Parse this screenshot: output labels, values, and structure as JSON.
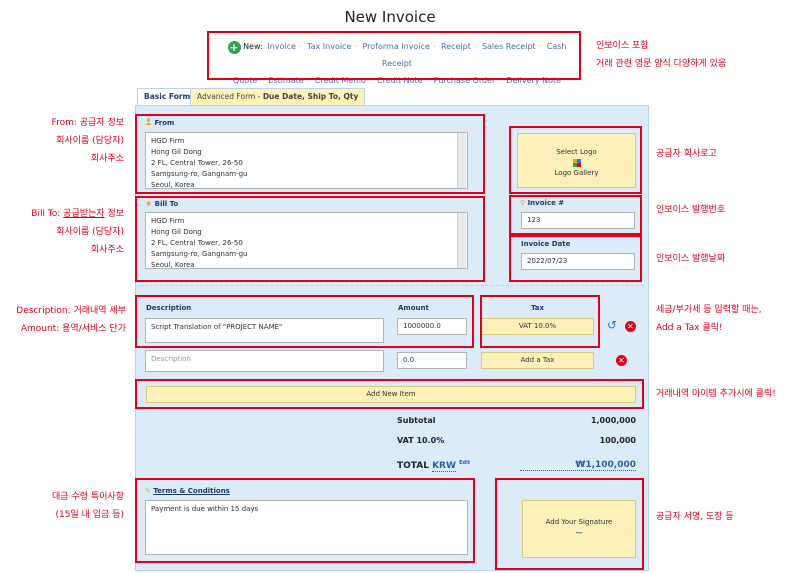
{
  "page": {
    "title": "New Invoice"
  },
  "new_bar": {
    "prefix": "New:",
    "items": [
      "Invoice",
      "Tax Invoice",
      "Proforma Invoice",
      "Receipt",
      "Sales Receipt",
      "Cash Receipt",
      "Quote",
      "Estimate",
      "Credit Memo",
      "Credit Note",
      "Purchase Order",
      "Delivery Note"
    ]
  },
  "tabs": {
    "basic": "Basic Form",
    "advanced_prefix": "Advanced Form - ",
    "advanced_bold": "Due Date, Ship To, Qty"
  },
  "from": {
    "label": "From",
    "lines": [
      "HGD Firm",
      "Hong Gil Dong",
      "2 FL, Central Tower, 26-50",
      "Samgsung-ro, Gangnam-gu",
      "Seoul, Korea"
    ]
  },
  "bill_to": {
    "label": "Bill To",
    "lines": [
      "HGD Firm",
      "Hong Gil Dong",
      "2 FL, Central Tower, 26-50",
      "Samgsung-ro, Gangnam-gu",
      "Seoul, Korea"
    ]
  },
  "logo": {
    "select": "Select Logo",
    "gallery": "Logo Gallery"
  },
  "invoice_no": {
    "label": "Invoice #",
    "value": "123"
  },
  "invoice_date": {
    "label": "Invoice Date",
    "value": "2022/07/23"
  },
  "items_header": {
    "description": "Description",
    "amount": "Amount",
    "tax": "Tax"
  },
  "item1": {
    "description": "Script Translation of \"PROJECT NAME\"",
    "amount": "1000000.0",
    "tax": "VAT 10.0%"
  },
  "item2": {
    "description_placeholder": "Description",
    "amount": "0.0",
    "tax_button": "Add a Tax"
  },
  "add_item": "Add New Item",
  "totals": {
    "subtotal_label": "Subtotal",
    "subtotal_value": "1,000,000",
    "vat_label": "VAT 10.0%",
    "vat_value": "100,000",
    "total_label": "TOTAL",
    "currency": "KRW",
    "edit": "Edit",
    "total_value": "₩1,100,000"
  },
  "terms": {
    "label": "Terms & Conditions",
    "value": "Payment is due within 15 days"
  },
  "signature": {
    "label": "Add Your Signature"
  },
  "annotations": {
    "from_1": "From: 공급자 정보",
    "from_2": "회사이름 (담당자)",
    "from_3": "회사주소",
    "bill_1a": "Bill To: ",
    "bill_1b": "공급받는자",
    "bill_1c": " 정보",
    "bill_2": "회사이름 (담당자)",
    "bill_3": "회사주소",
    "desc_1": "Description: 거래내역 세부",
    "desc_2": "Amount: 용역/서비스 단가",
    "terms_1": "대금 수령 특이사항",
    "terms_2": "(15일 내 입금 등)",
    "invtypes_1": "인보이스 포함",
    "invtypes_2": "거래 관련 영문 양식 다양하게 있음",
    "logo": "공급자 회사로고",
    "invno": "인보이스 발행번호",
    "invdate": "인보이스 발행날짜",
    "tax_1": "세금/부가세 등 입력할 때는,",
    "tax_2": "Add a Tax 클릭!",
    "additem": "거래내역 아이템 추가시에 클릭!",
    "sign": "공급자 서명, 도장 등"
  }
}
